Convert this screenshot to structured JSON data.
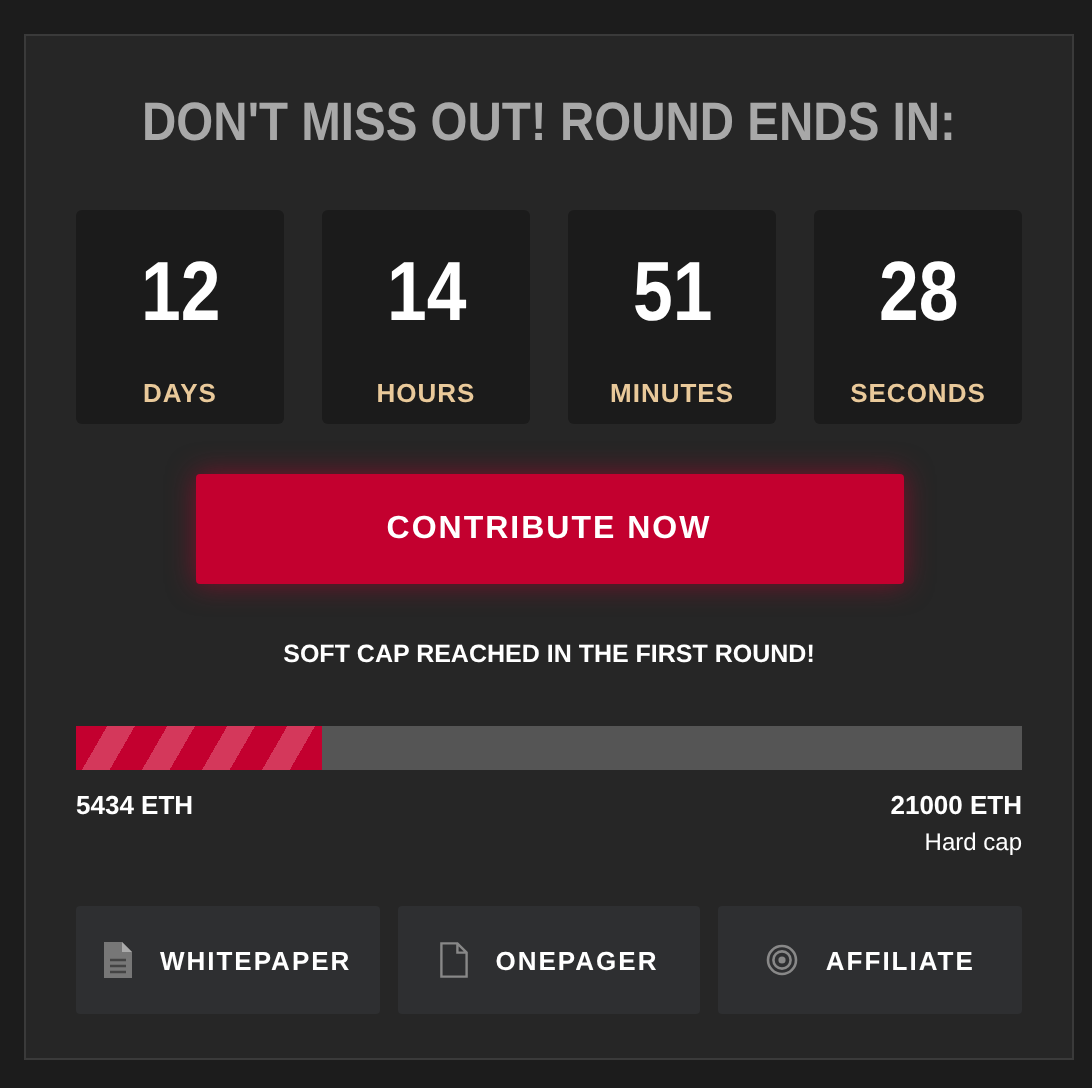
{
  "title": "DON'T MISS OUT! ROUND ENDS IN:",
  "countdown": [
    {
      "value": "12",
      "unit": "DAYS"
    },
    {
      "value": "14",
      "unit": "HOURS"
    },
    {
      "value": "51",
      "unit": "MINUTES"
    },
    {
      "value": "28",
      "unit": "SECONDS"
    }
  ],
  "cta_button": "CONTRIBUTE NOW",
  "notice": "SOFT CAP REACHED IN THE FIRST ROUND!",
  "progress": {
    "level": 0.259,
    "raised": "5434 ETH",
    "hard_cap": "21000 ETH",
    "hard_cap_label": "Hard cap"
  },
  "links": [
    {
      "kind": "document",
      "label": "WHITEPAPER"
    },
    {
      "kind": "page",
      "label": "ONEPAGER"
    },
    {
      "kind": "target",
      "label": "AFFILIATE"
    }
  ]
}
